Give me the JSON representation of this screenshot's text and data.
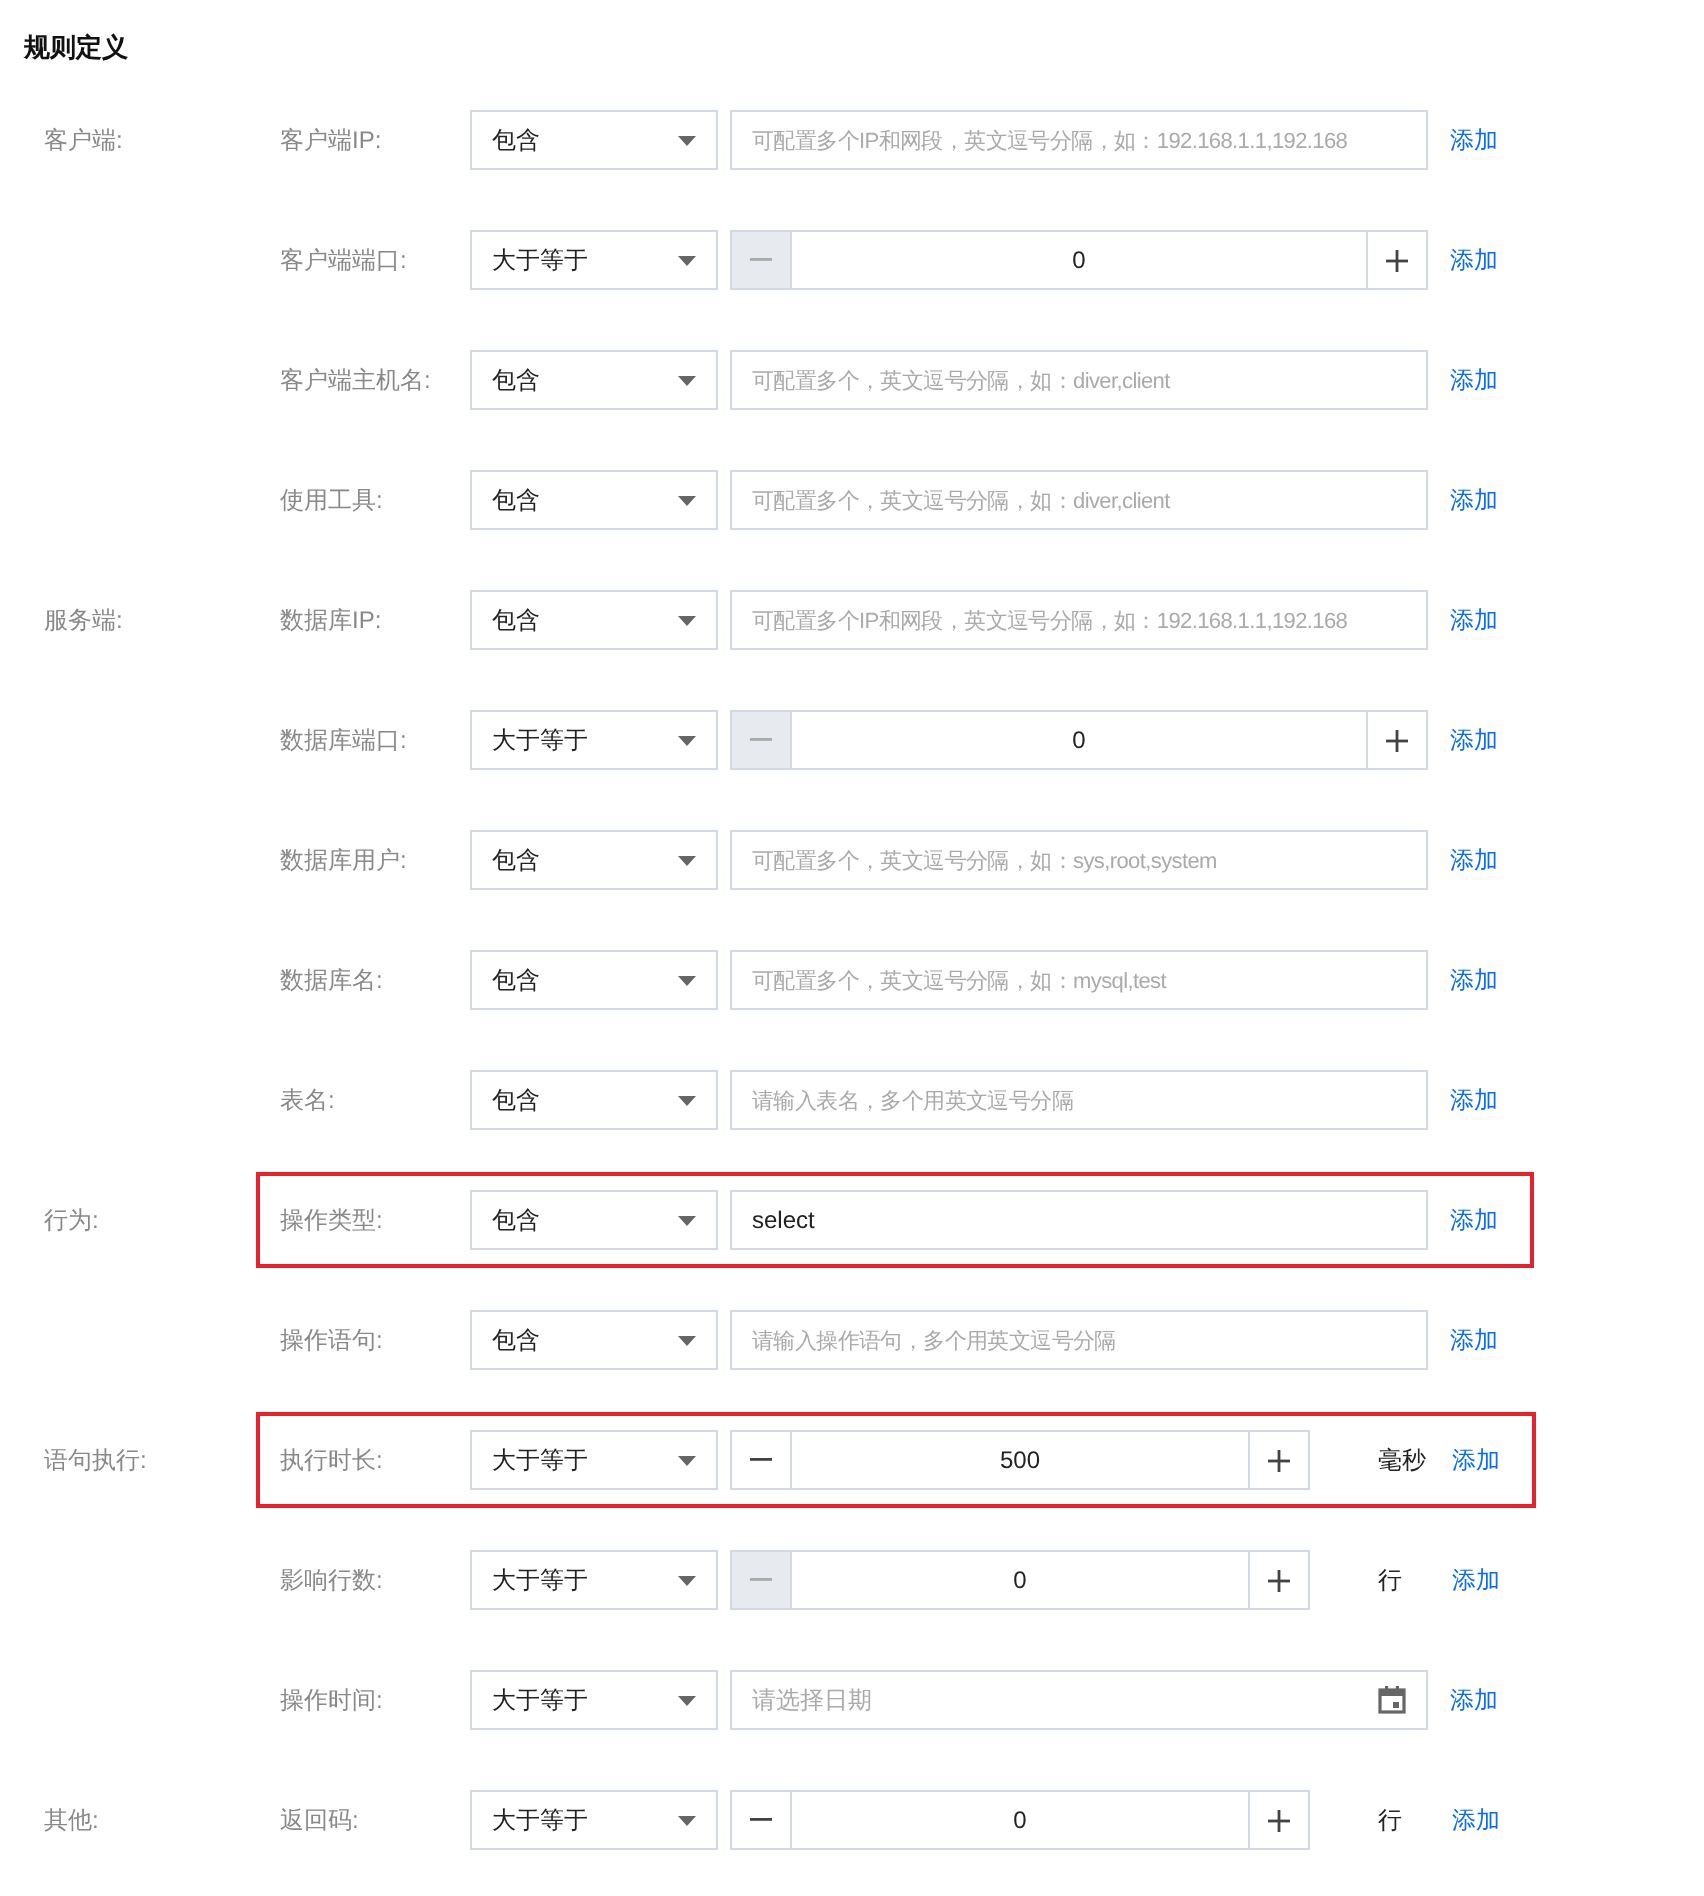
{
  "title": "规则定义",
  "groups": [
    {
      "label": "客户端:",
      "rows": [
        {
          "label": "客户端IP:",
          "operator": "包含",
          "kind": "text",
          "placeholder": "可配置多个IP和网段，英文逗号分隔，如：192.168.1.1,192.168",
          "highlighted": false,
          "add": "添加"
        },
        {
          "label": "客户端端口:",
          "operator": "大于等于",
          "kind": "number",
          "value": "0",
          "minus_disabled": true,
          "highlighted": false,
          "add": "添加"
        },
        {
          "label": "客户端主机名:",
          "operator": "包含",
          "kind": "text",
          "placeholder": "可配置多个，英文逗号分隔，如：diver,client",
          "highlighted": false,
          "add": "添加"
        },
        {
          "label": "使用工具:",
          "operator": "包含",
          "kind": "text",
          "placeholder": "可配置多个，英文逗号分隔，如：diver,client",
          "highlighted": false,
          "add": "添加"
        }
      ]
    },
    {
      "label": "服务端:",
      "rows": [
        {
          "label": "数据库IP:",
          "operator": "包含",
          "kind": "text",
          "placeholder": "可配置多个IP和网段，英文逗号分隔，如：192.168.1.1,192.168",
          "highlighted": false,
          "add": "添加"
        },
        {
          "label": "数据库端口:",
          "operator": "大于等于",
          "kind": "number",
          "value": "0",
          "minus_disabled": true,
          "highlighted": false,
          "add": "添加"
        },
        {
          "label": "数据库用户:",
          "operator": "包含",
          "kind": "text",
          "placeholder": "可配置多个，英文逗号分隔，如：sys,root,system",
          "highlighted": false,
          "add": "添加"
        },
        {
          "label": "数据库名:",
          "operator": "包含",
          "kind": "text",
          "placeholder": "可配置多个，英文逗号分隔，如：mysql,test",
          "highlighted": false,
          "add": "添加"
        },
        {
          "label": "表名:",
          "operator": "包含",
          "kind": "text",
          "placeholder": "请输入表名，多个用英文逗号分隔",
          "highlighted": false,
          "add": "添加"
        }
      ]
    },
    {
      "label": "行为:",
      "rows": [
        {
          "label": "操作类型:",
          "operator": "包含",
          "kind": "text",
          "value": "select",
          "highlighted": true,
          "add": "添加"
        },
        {
          "label": "操作语句:",
          "operator": "包含",
          "kind": "text",
          "placeholder": "请输入操作语句，多个用英文逗号分隔",
          "highlighted": false,
          "add": "添加"
        }
      ]
    },
    {
      "label": "语句执行:",
      "rows": [
        {
          "label": "执行时长:",
          "operator": "大于等于",
          "kind": "number",
          "value": "500",
          "minus_disabled": false,
          "unit": "毫秒",
          "highlighted": true,
          "add": "添加"
        },
        {
          "label": "影响行数:",
          "operator": "大于等于",
          "kind": "number",
          "value": "0",
          "minus_disabled": true,
          "unit": "行",
          "highlighted": false,
          "add": "添加"
        },
        {
          "label": "操作时间:",
          "operator": "大于等于",
          "kind": "date",
          "placeholder": "请选择日期",
          "highlighted": false,
          "add": "添加"
        }
      ]
    },
    {
      "label": "其他:",
      "rows": [
        {
          "label": "返回码:",
          "operator": "大于等于",
          "kind": "number",
          "value": "0",
          "minus_disabled": false,
          "unit": "行",
          "highlighted": false,
          "add": "添加"
        }
      ]
    }
  ]
}
